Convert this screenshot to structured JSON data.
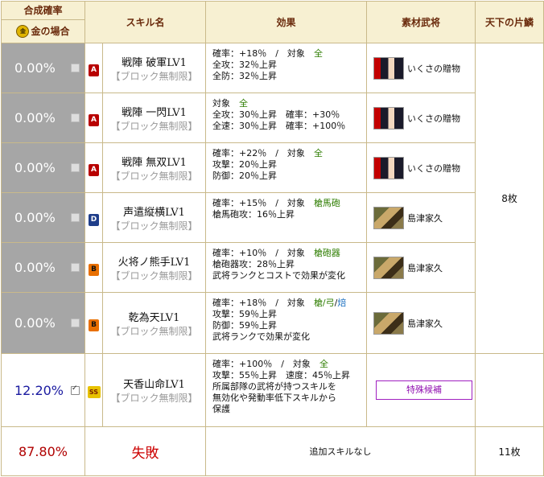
{
  "header": {
    "prob_title": "合成確率",
    "prob_sub": "金の場合",
    "gold_icon_text": "金",
    "skill_name": "スキル名",
    "effect": "効果",
    "material": "素材武将",
    "tenka": "天下の片鱗"
  },
  "rows": [
    {
      "rate": "0.00%",
      "checked": false,
      "rank": "A",
      "skill": "戦陣 破軍LV1",
      "limit": "【ブロック無制限】",
      "effects": [
        {
          "parts": [
            {
              "t": "確率：+18％　/　対象　"
            },
            {
              "t": "全",
              "c": "g"
            }
          ]
        },
        {
          "parts": [
            {
              "t": "全攻：32％上昇"
            }
          ]
        },
        {
          "parts": [
            {
              "t": "全防：32％上昇"
            }
          ]
        }
      ],
      "material": {
        "name": "いくさの贈物",
        "portrait": "kunoichi-portrait"
      }
    },
    {
      "rate": "0.00%",
      "checked": false,
      "rank": "A",
      "skill": "戦陣 一閃LV1",
      "limit": "【ブロック無制限】",
      "effects": [
        {
          "parts": [
            {
              "t": "対象　"
            },
            {
              "t": "全",
              "c": "g"
            }
          ]
        },
        {
          "parts": [
            {
              "t": "全攻：30％上昇　確率：+30％"
            }
          ]
        },
        {
          "parts": [
            {
              "t": "全速：30％上昇　確率：+100％"
            }
          ]
        }
      ],
      "material": {
        "name": "いくさの贈物",
        "portrait": "kunoichi-portrait"
      }
    },
    {
      "rate": "0.00%",
      "checked": false,
      "rank": "A",
      "skill": "戦陣 無双LV1",
      "limit": "【ブロック無制限】",
      "effects": [
        {
          "parts": [
            {
              "t": "確率：+22％　/　対象　"
            },
            {
              "t": "全",
              "c": "g"
            }
          ]
        },
        {
          "parts": [
            {
              "t": "攻撃：20％上昇"
            }
          ]
        },
        {
          "parts": [
            {
              "t": "防御：20％上昇"
            }
          ]
        }
      ],
      "material": {
        "name": "いくさの贈物",
        "portrait": "kunoichi-portrait"
      }
    },
    {
      "rate": "0.00%",
      "checked": false,
      "rank": "D",
      "skill": "声遣縦横LV1",
      "limit": "【ブロック無制限】",
      "effects": [
        {
          "parts": [
            {
              "t": "確率：+15％　/　対象　"
            },
            {
              "t": "槍馬砲",
              "c": "g"
            }
          ]
        },
        {
          "parts": [
            {
              "t": "槍馬砲攻：16％上昇"
            }
          ]
        }
      ],
      "material": {
        "name": "島津家久",
        "portrait": "shimazu-portrait"
      }
    },
    {
      "rate": "0.00%",
      "checked": false,
      "rank": "B",
      "skill": "火将ノ熊手LV1",
      "limit": "【ブロック無制限】",
      "effects": [
        {
          "parts": [
            {
              "t": "確率：+10％　/　対象　"
            },
            {
              "t": "槍砲器",
              "c": "g"
            }
          ]
        },
        {
          "parts": [
            {
              "t": "槍砲器攻：28％上昇"
            }
          ]
        },
        {
          "parts": [
            {
              "t": "武将ランクとコストで効果が変化"
            }
          ]
        }
      ],
      "material": {
        "name": "島津家久",
        "portrait": "shimazu-portrait"
      }
    },
    {
      "rate": "0.00%",
      "checked": false,
      "rank": "B",
      "skill": "乾為天LV1",
      "limit": "【ブロック無制限】",
      "effects": [
        {
          "parts": [
            {
              "t": "確率：+18％　/　対象　"
            },
            {
              "t": "槍/弓",
              "c": "g"
            },
            {
              "t": "/"
            },
            {
              "t": "焙",
              "c": "b"
            }
          ]
        },
        {
          "parts": [
            {
              "t": "攻撃：59％上昇"
            }
          ]
        },
        {
          "parts": [
            {
              "t": "防御：59％上昇"
            }
          ]
        },
        {
          "parts": [
            {
              "t": "武将ランクで効果が変化"
            }
          ]
        }
      ],
      "material": {
        "name": "島津家久",
        "portrait": "shimazu-portrait"
      }
    },
    {
      "rate": "12.20%",
      "checked": true,
      "rank": "SS",
      "skill": "天香山命LV1",
      "limit": "【ブロック無制限】",
      "effects": [
        {
          "parts": [
            {
              "t": "確率：+100％　/　対象　"
            },
            {
              "t": "全",
              "c": "g"
            }
          ]
        },
        {
          "parts": [
            {
              "t": "攻撃：55％上昇　速度：45％上昇"
            }
          ]
        },
        {
          "parts": [
            {
              "t": "所属部隊の武将が持つスキルを"
            }
          ]
        },
        {
          "parts": [
            {
              "t": "無効化や発動率低下スキルから"
            }
          ]
        },
        {
          "parts": [
            {
              "t": "保護"
            }
          ]
        }
      ],
      "material": {
        "button": "特殊候補"
      }
    }
  ],
  "tenka_upper": "8枚",
  "last": {
    "rate": "87.80%",
    "result": "失敗",
    "note": "追加スキルなし",
    "tenka": "11枚"
  },
  "colors": {
    "header_bg": "#f7f0d2",
    "header_text": "#6a2a0c",
    "border": "#c9b98a",
    "rate_gray_bg": "#a6a6a6",
    "rate_blue": "#1a1aa0",
    "rate_red": "#b00000",
    "target_green": "#2e7d00",
    "special_purple": "#9010b0"
  }
}
